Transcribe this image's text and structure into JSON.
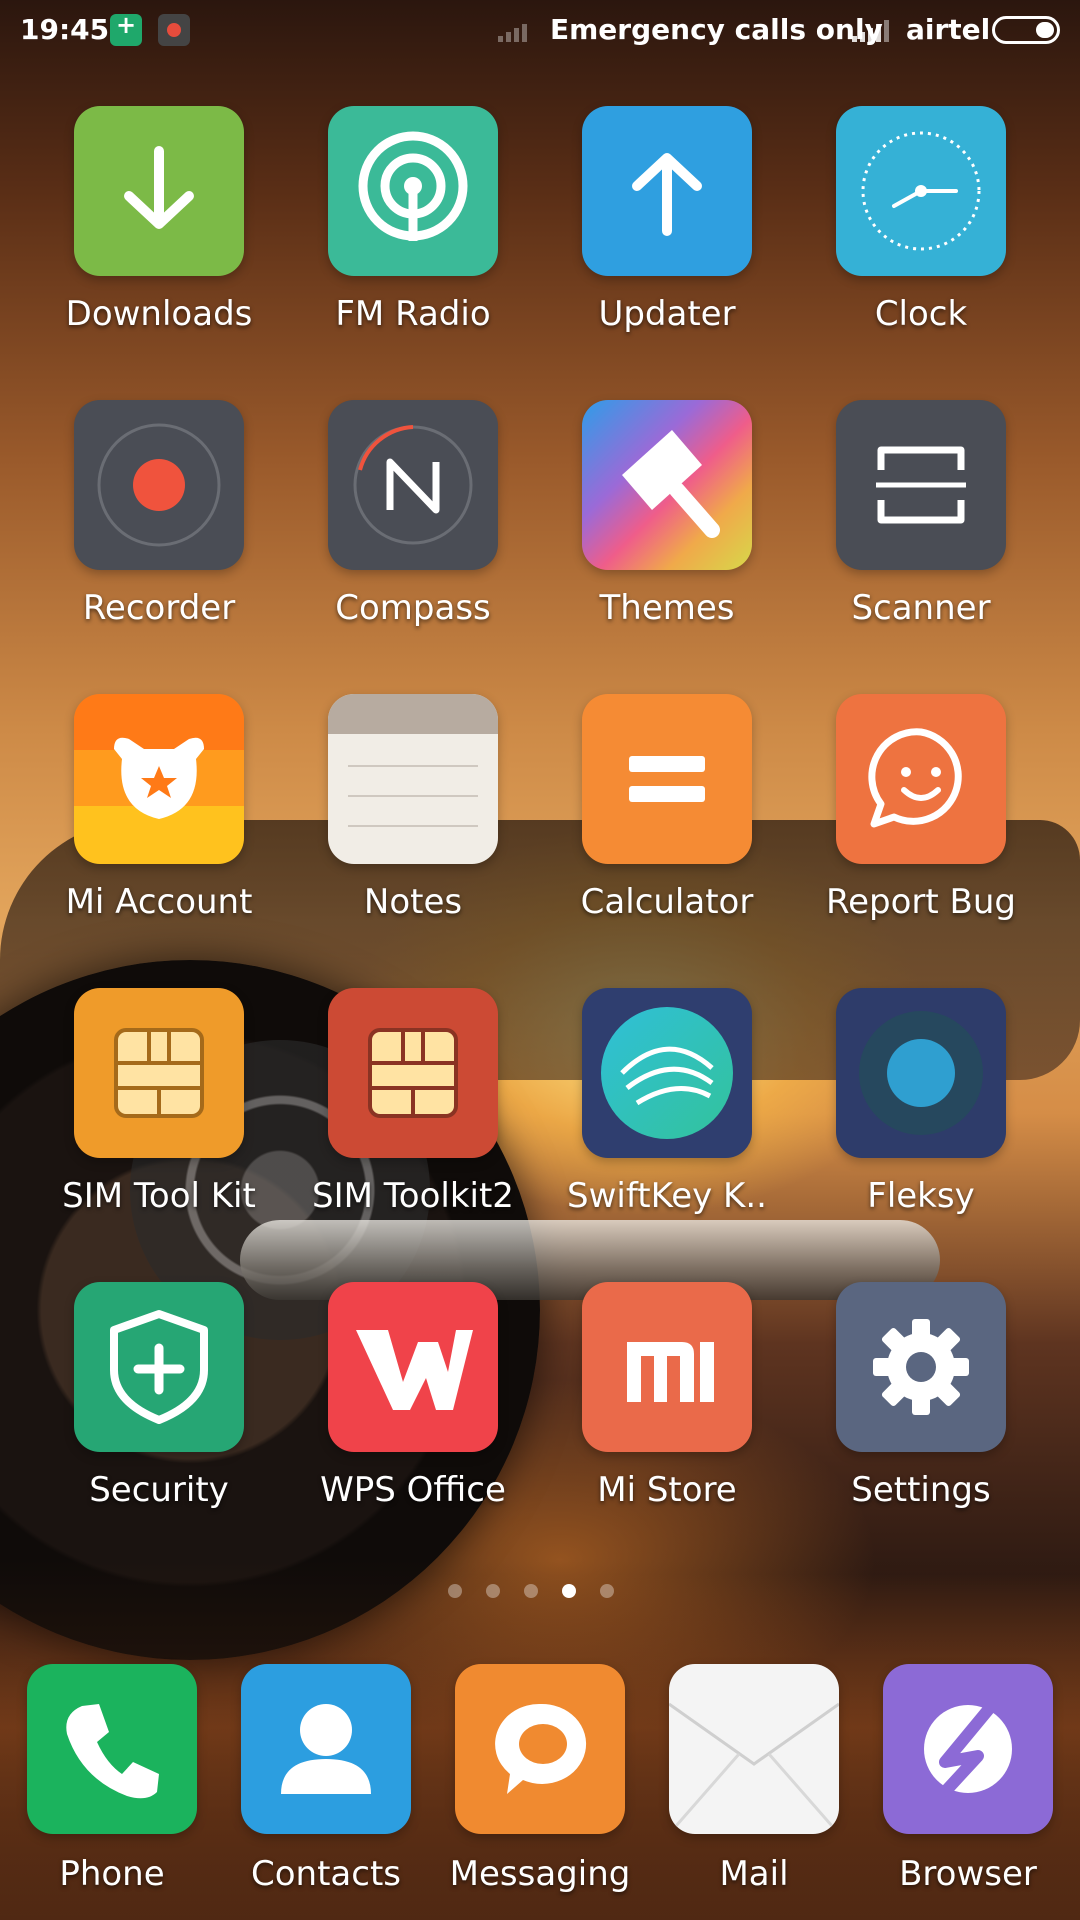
{
  "status_bar": {
    "time": "19:45",
    "emergency_text": "Emergency calls only",
    "carrier": "airtel",
    "icons": [
      "security-shield-icon",
      "screen-record-icon",
      "no-signal-icon",
      "signal-icon",
      "battery-icon"
    ]
  },
  "apps": [
    {
      "label": "Downloads",
      "icon": "download-arrow-icon",
      "color": "#7cba47"
    },
    {
      "label": "FM Radio",
      "icon": "radio-antenna-icon",
      "color": "#3bba98"
    },
    {
      "label": "Updater",
      "icon": "upload-arrow-icon",
      "color": "#2f9fe0"
    },
    {
      "label": "Clock",
      "icon": "clock-face-icon",
      "color": "#35b1d6"
    },
    {
      "label": "Recorder",
      "icon": "record-dot-icon",
      "color": "#4a4d55"
    },
    {
      "label": "Compass",
      "icon": "compass-n-icon",
      "color": "#4a4d55"
    },
    {
      "label": "Themes",
      "icon": "paint-brush-icon",
      "color": "#e37ab0"
    },
    {
      "label": "Scanner",
      "icon": "scanner-frame-icon",
      "color": "#4a4d55"
    },
    {
      "label": "Mi Account",
      "icon": "mi-bunny-icon",
      "color": "#f9a825"
    },
    {
      "label": "Notes",
      "icon": "notepad-icon",
      "color": "#f1ede6"
    },
    {
      "label": "Calculator",
      "icon": "equals-icon",
      "color": "#f58b34"
    },
    {
      "label": "Report Bug",
      "icon": "smiley-chat-icon",
      "color": "#ee7340"
    },
    {
      "label": "SIM Tool Kit",
      "icon": "sim-chip-icon",
      "color": "#ef9b2a"
    },
    {
      "label": "SIM Toolkit2",
      "icon": "sim-chip-icon",
      "color": "#cc4a34"
    },
    {
      "label": "SwiftKey K..",
      "icon": "swiftkey-swirl-icon",
      "color": "#2f3e6f"
    },
    {
      "label": "Fleksy",
      "icon": "fleksy-ring-icon",
      "color": "#2e3c6a"
    },
    {
      "label": "Security",
      "icon": "shield-plus-icon",
      "color": "#26a674"
    },
    {
      "label": "WPS Office",
      "icon": "wps-w-icon",
      "color": "#f0434a"
    },
    {
      "label": "Mi Store",
      "icon": "mi-logo-icon",
      "color": "#ea6a4a"
    },
    {
      "label": "Settings",
      "icon": "gear-icon",
      "color": "#5a6680"
    }
  ],
  "page_indicator": {
    "count": 5,
    "active": 4
  },
  "dock": [
    {
      "label": "Phone",
      "icon": "phone-handset-icon",
      "color": "#1bb35d"
    },
    {
      "label": "Contacts",
      "icon": "person-icon",
      "color": "#2c9ee0"
    },
    {
      "label": "Messaging",
      "icon": "chat-bubble-icon",
      "color": "#f08a30"
    },
    {
      "label": "Mail",
      "icon": "envelope-icon",
      "color": "#f4f4f4"
    },
    {
      "label": "Browser",
      "icon": "browser-swirl-icon",
      "color": "#8c6ad6"
    }
  ]
}
